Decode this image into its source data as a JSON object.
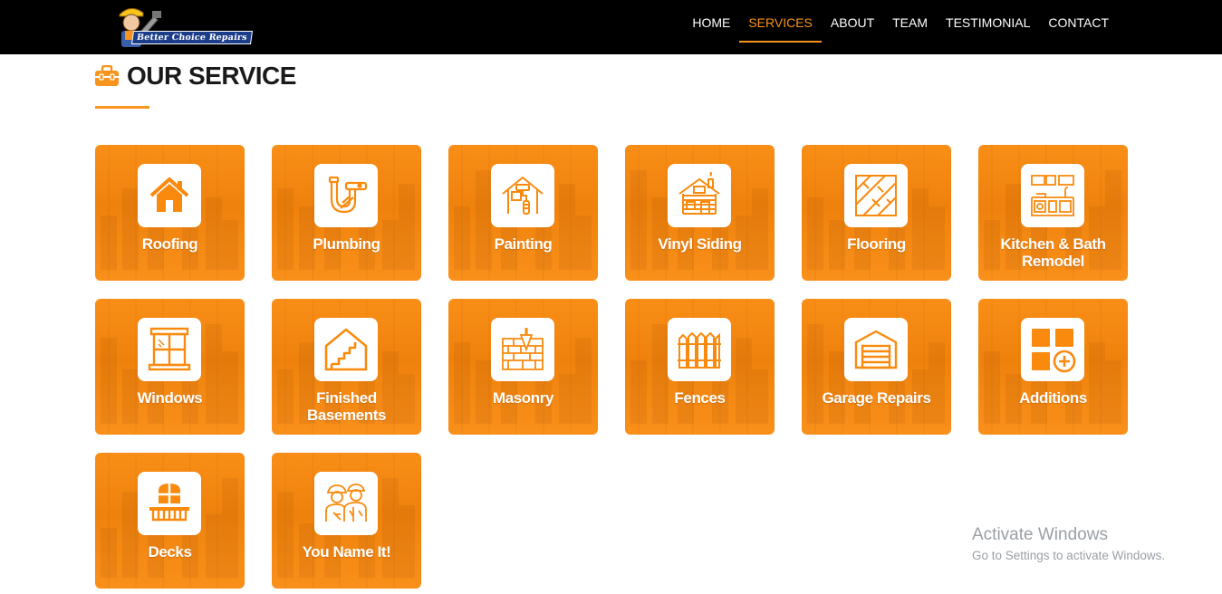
{
  "logo": {
    "text": "Better Choice Repairs"
  },
  "nav": {
    "items": [
      {
        "label": "HOME",
        "active": false
      },
      {
        "label": "SERVICES",
        "active": true
      },
      {
        "label": "ABOUT",
        "active": false
      },
      {
        "label": "TEAM",
        "active": false
      },
      {
        "label": "TESTIMONIAL",
        "active": false
      },
      {
        "label": "CONTACT",
        "active": false
      }
    ]
  },
  "section": {
    "title": "OUR SERVICE",
    "icon": "toolbox-icon"
  },
  "services": [
    {
      "label": "Roofing",
      "icon": "house-icon"
    },
    {
      "label": "Plumbing",
      "icon": "pipe-icon"
    },
    {
      "label": "Painting",
      "icon": "paint-roller-icon"
    },
    {
      "label": "Vinyl Siding",
      "icon": "log-cabin-icon"
    },
    {
      "label": "Flooring",
      "icon": "floor-tiles-icon"
    },
    {
      "label": "Kitchen & Bath Remodel",
      "icon": "kitchen-icon"
    },
    {
      "label": "Windows",
      "icon": "window-icon"
    },
    {
      "label": "Finished Basements",
      "icon": "basement-stairs-icon"
    },
    {
      "label": "Masonry",
      "icon": "brick-trowel-icon"
    },
    {
      "label": "Fences",
      "icon": "fence-icon"
    },
    {
      "label": "Garage Repairs",
      "icon": "garage-icon"
    },
    {
      "label": "Additions",
      "icon": "add-blocks-icon"
    },
    {
      "label": "Decks",
      "icon": "deck-icon"
    },
    {
      "label": "You Name It!",
      "icon": "workers-icon"
    }
  ],
  "watermark": {
    "title": "Activate Windows",
    "subtitle": "Go to Settings to activate Windows."
  },
  "colors": {
    "accent": "#f7941d",
    "card": "#f98a0e",
    "navbar": "#000000"
  }
}
